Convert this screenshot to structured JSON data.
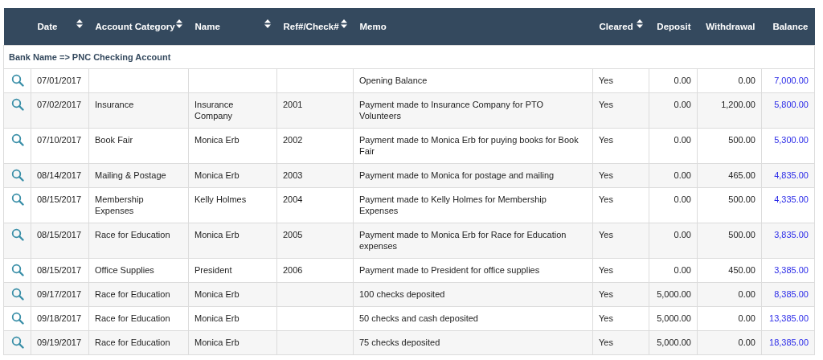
{
  "table": {
    "columns": [
      {
        "label": "Date",
        "sortable": true,
        "kind": "text"
      },
      {
        "label": "Account Category",
        "sortable": true,
        "kind": "text"
      },
      {
        "label": "Name",
        "sortable": true,
        "kind": "text"
      },
      {
        "label": "Ref#/Check#",
        "sortable": true,
        "kind": "text"
      },
      {
        "label": "Memo",
        "sortable": false,
        "kind": "text"
      },
      {
        "label": "Cleared",
        "sortable": true,
        "kind": "text"
      },
      {
        "label": "Deposit",
        "sortable": false,
        "kind": "amount"
      },
      {
        "label": "Withdrawal",
        "sortable": false,
        "kind": "amount"
      },
      {
        "label": "Balance",
        "sortable": false,
        "kind": "amount"
      }
    ],
    "group": "Bank Name => PNC Checking Account",
    "rows": [
      {
        "date": "07/01/2017",
        "memo": "Opening Balance",
        "cleared": "Yes",
        "deposit": "0.00",
        "withdrawal": "0.00",
        "balance": "7,000.00"
      },
      {
        "date": "07/02/2017",
        "category": "Insurance",
        "name": "Insurance Company",
        "ref": "2001",
        "memo": "Payment made to Insurance Company for PTO Volunteers",
        "cleared": "Yes",
        "deposit": "0.00",
        "withdrawal": "1,200.00",
        "balance": "5,800.00"
      },
      {
        "date": "07/10/2017",
        "category": "Book Fair",
        "name": "Monica Erb",
        "ref": "2002",
        "memo": "Payment made to Monica Erb for puying books for Book Fair",
        "cleared": "Yes",
        "deposit": "0.00",
        "withdrawal": "500.00",
        "balance": "5,300.00"
      },
      {
        "date": "08/14/2017",
        "category": "Mailing & Postage",
        "name": "Monica Erb",
        "ref": "2003",
        "memo": "Payment made to Monica for postage and mailing",
        "cleared": "Yes",
        "deposit": "0.00",
        "withdrawal": "465.00",
        "balance": "4,835.00"
      },
      {
        "date": "08/15/2017",
        "category": "Membership Expenses",
        "name": "Kelly Holmes",
        "ref": "2004",
        "memo": "Payment made to Kelly Holmes for Membership Expenses",
        "cleared": "Yes",
        "deposit": "0.00",
        "withdrawal": "500.00",
        "balance": "4,335.00"
      },
      {
        "date": "08/15/2017",
        "category": "Race for Education",
        "name": "Monica Erb",
        "ref": "2005",
        "memo": "Payment made to Monica Erb for Race for Education expenses",
        "cleared": "Yes",
        "deposit": "0.00",
        "withdrawal": "500.00",
        "balance": "3,835.00"
      },
      {
        "date": "08/15/2017",
        "category": "Office Supplies",
        "name": "President",
        "ref": "2006",
        "memo": "Payment made to President for office supplies",
        "cleared": "Yes",
        "deposit": "0.00",
        "withdrawal": "450.00",
        "balance": "3,385.00"
      },
      {
        "date": "09/17/2017",
        "category": "Race for Education",
        "name": "Monica Erb",
        "memo": "100 checks deposited",
        "cleared": "Yes",
        "deposit": "5,000.00",
        "withdrawal": "0.00",
        "balance": "8,385.00"
      },
      {
        "date": "09/18/2017",
        "category": "Race for Education",
        "name": "Monica Erb",
        "memo": "50 checks and cash deposited",
        "cleared": "Yes",
        "deposit": "5,000.00",
        "withdrawal": "0.00",
        "balance": "13,385.00"
      },
      {
        "date": "09/19/2017",
        "category": "Race for Education",
        "name": "Monica Erb",
        "memo": "75 checks deposited",
        "cleared": "Yes",
        "deposit": "5,000.00",
        "withdrawal": "0.00",
        "balance": "18,385.00"
      }
    ]
  }
}
